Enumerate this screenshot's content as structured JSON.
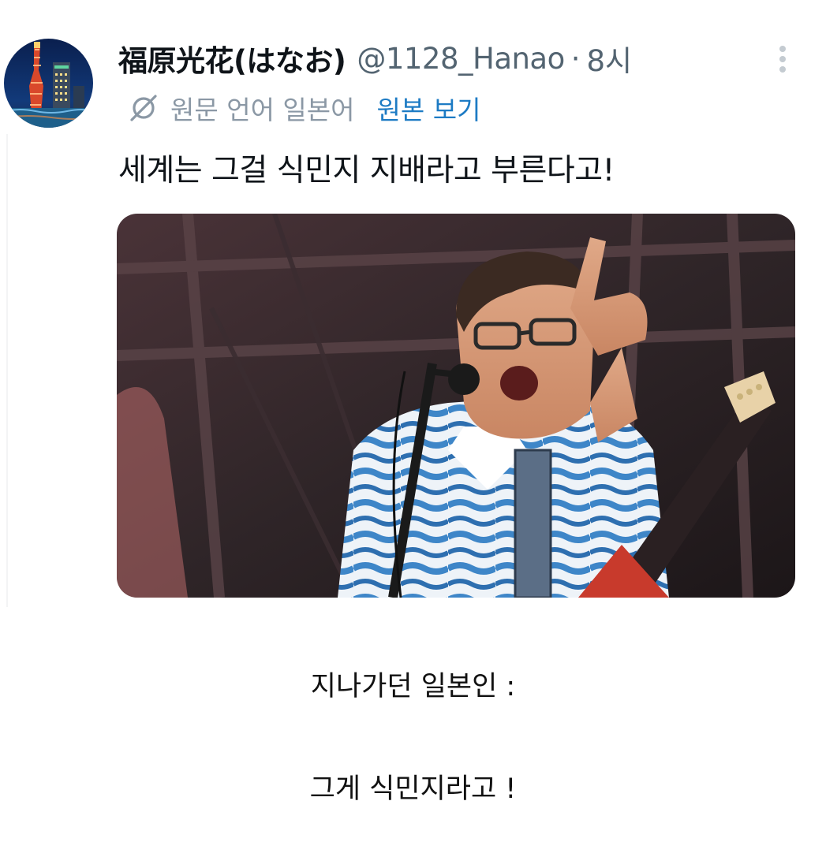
{
  "tweet": {
    "display_name": "福原光花(はなお)",
    "handle": "@1128_Hanao",
    "separator": "·",
    "time": "8시",
    "source_language": "원문 언어 일본어",
    "view_original_label": "원본 보기",
    "text": "세계는 그걸 식민지 지배라고 부른다고!",
    "icons": {
      "avatar": "avatar-port-tower-night",
      "more": "more-vertical-icon",
      "translation": "globe-slash-icon"
    },
    "media_description_alt": ""
  },
  "captions": {
    "line1": "지나가던 일본인 :",
    "line2": "그게 식민지라고 !"
  },
  "colors": {
    "text_primary": "#0f1419",
    "text_secondary": "#536471",
    "link": "#1d7bc4",
    "muted": "#8b98a5"
  }
}
